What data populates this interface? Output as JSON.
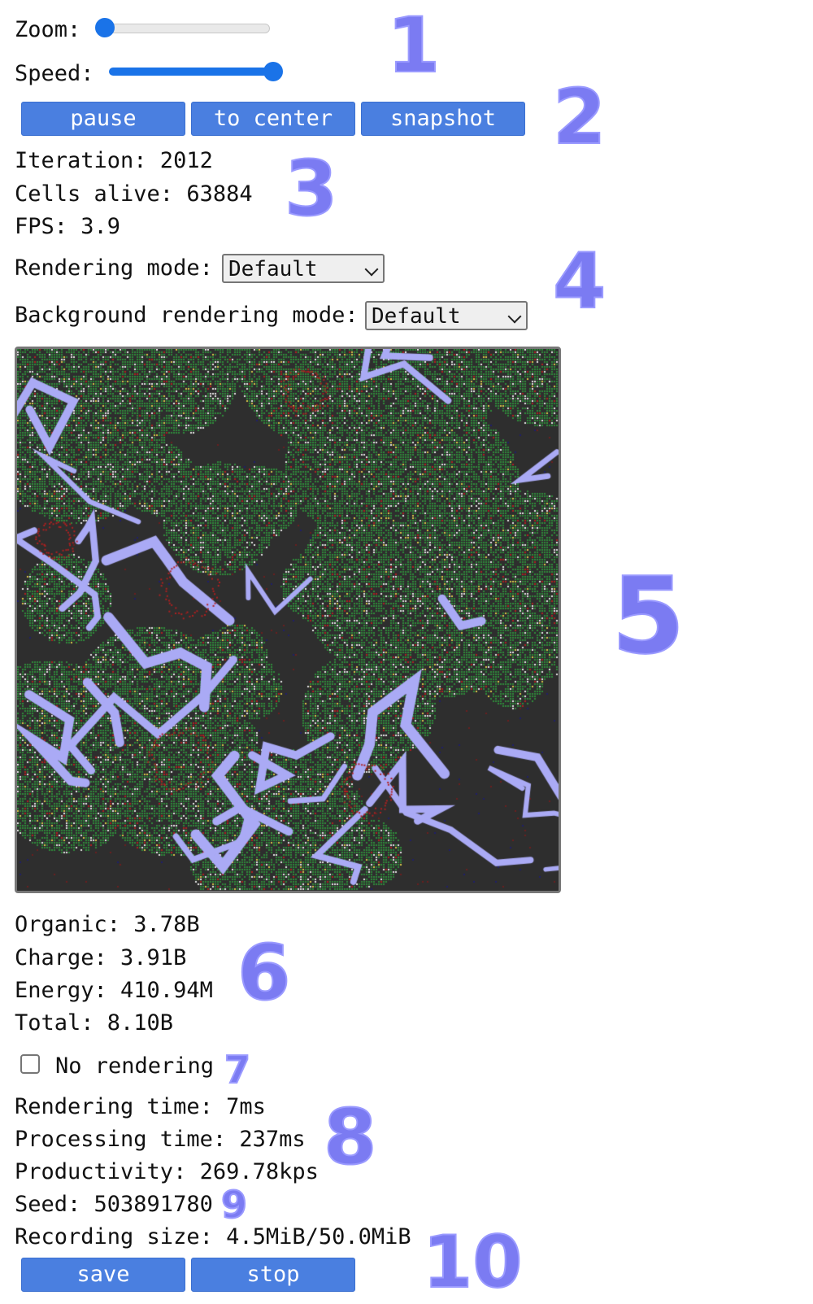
{
  "controls": {
    "zoom_label": "Zoom:",
    "zoom_value": 0.0,
    "speed_label": "Speed:",
    "speed_value": 1.0
  },
  "buttons": {
    "pause": "pause",
    "to_center": "to center",
    "snapshot": "snapshot"
  },
  "stats": {
    "iteration": "Iteration: 2012",
    "cells_alive": "Cells alive: 63884",
    "fps": "FPS: 3.9"
  },
  "render": {
    "mode_label": "Rendering mode:",
    "mode_value": "Default",
    "bg_mode_label": "Background rendering mode:",
    "bg_mode_value": "Default"
  },
  "resources": {
    "organic": "Organic: 3.78B",
    "charge": "Charge: 3.91B",
    "energy": "Energy: 410.94M",
    "total": "Total: 8.10B"
  },
  "no_rendering": {
    "label": "No rendering",
    "checked": false
  },
  "timing": {
    "rendering_time": "Rendering time: 7ms",
    "processing_time": "Processing time: 237ms",
    "productivity": "Productivity: 269.78kps"
  },
  "seed": "Seed: 503891780",
  "recording": {
    "size": "Recording size: 4.5MiB/50.0MiB",
    "save": "save",
    "stop": "stop"
  },
  "annotations": [
    "1",
    "2",
    "3",
    "4",
    "5",
    "6",
    "7",
    "8",
    "9",
    "10"
  ],
  "colors": {
    "accent": "#4a7fe0",
    "annotation": "#7b7bf2",
    "grid_dark": "#2e2e2e",
    "cell_green": "#2f8a3a",
    "water": "#aaaaf5",
    "cell_red": "#b02020"
  }
}
